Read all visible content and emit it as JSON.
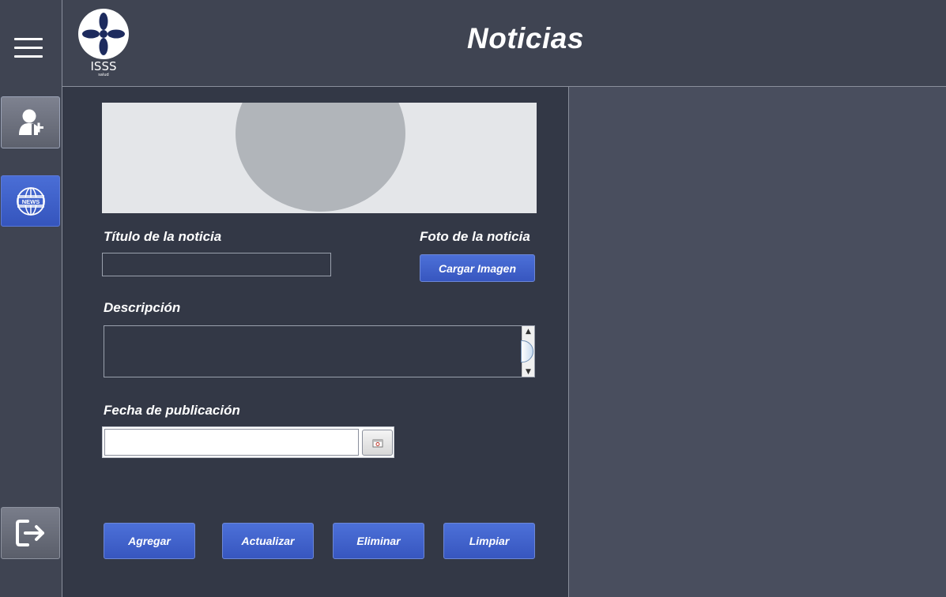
{
  "header": {
    "title": "Noticias",
    "logo_text": "ISSS",
    "logo_subtext": "salud"
  },
  "sidebar": {
    "menu_icon": "hamburger-icon",
    "items": [
      {
        "icon": "add-user-icon",
        "active": false
      },
      {
        "icon": "news-globe-icon",
        "label": "NEWS",
        "active": true
      },
      {
        "icon": "logout-icon",
        "active": false
      }
    ]
  },
  "form": {
    "title_label": "Título de la noticia",
    "title_value": "",
    "photo_label": "Foto de la noticia",
    "load_image_label": "Cargar Imagen",
    "description_label": "Descripción",
    "description_value": "",
    "date_label": "Fecha de publicación",
    "date_value": ""
  },
  "actions": {
    "add_label": "Agregar",
    "update_label": "Actualizar",
    "delete_label": "Eliminar",
    "clear_label": "Limpiar"
  },
  "colors": {
    "background": "#3f4452",
    "form_panel": "#333846",
    "right_panel": "#494e5e",
    "accent_blue": "#3f62cc",
    "text": "#ffffff"
  }
}
